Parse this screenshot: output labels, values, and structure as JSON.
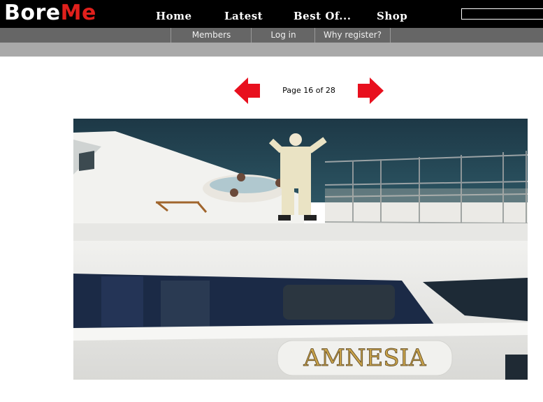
{
  "site": {
    "logo_part1": "Bore",
    "logo_part2": "Me"
  },
  "main_nav": [
    {
      "label": "Home"
    },
    {
      "label": "Latest"
    },
    {
      "label": "Best Of..."
    },
    {
      "label": "Shop"
    }
  ],
  "sub_nav": [
    {
      "label": "Members"
    },
    {
      "label": "Log in"
    },
    {
      "label": "Why register?"
    }
  ],
  "search": {
    "value": ""
  },
  "pager": {
    "text": "Page 16 of 28"
  },
  "photo": {
    "hull_name": "AMNESIA"
  },
  "colors": {
    "brand_red": "#e0201c",
    "arrow_red": "#e8101e",
    "subnav_grey": "#666666"
  },
  "icons": {
    "prev": "left-arrow-icon",
    "next": "right-arrow-icon"
  }
}
